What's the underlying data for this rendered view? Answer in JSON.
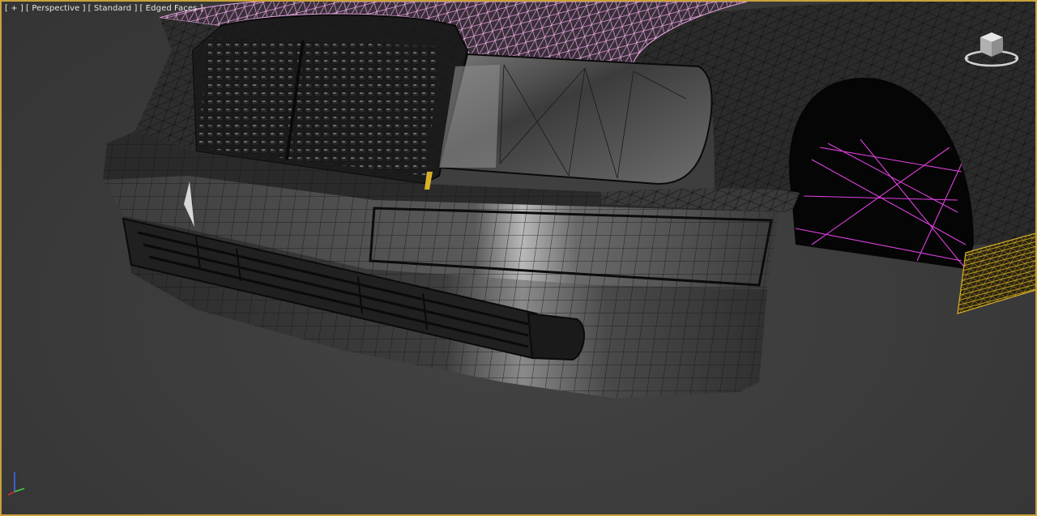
{
  "viewport": {
    "labels": [
      {
        "id": "plus",
        "text": "[ + ]"
      },
      {
        "id": "view",
        "text": "[ Perspective ]"
      },
      {
        "id": "shading",
        "text": "[ Standard ]"
      },
      {
        "id": "faces",
        "text": "[ Edged Faces ]"
      }
    ],
    "border_color": "#c9a23a",
    "background_color": "#3a3a3a"
  },
  "scene": {
    "selected_wire_color": "#e8a8e0",
    "wheel_wire_color": "#e040e0",
    "side_part_wire_color": "#d7b12a",
    "mesh_edge_color": "#111111"
  },
  "icons": {
    "viewcube": "viewcube-icon",
    "axis": "axis-tripod-icon"
  }
}
